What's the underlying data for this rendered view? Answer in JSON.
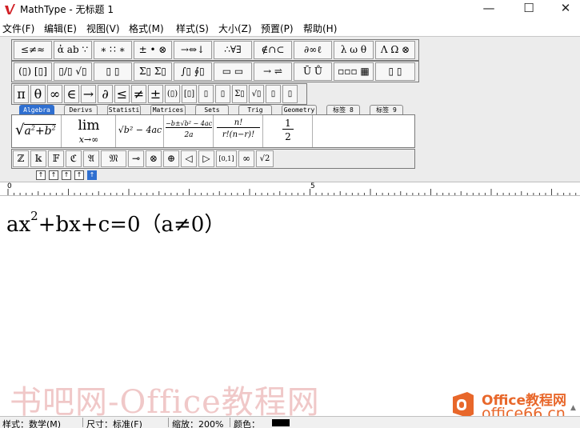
{
  "window": {
    "title": "MathType - 无标题 1",
    "controls": {
      "minimize": "—",
      "maximize": "☐",
      "close": "✕"
    }
  },
  "menu": [
    "文件(F)",
    "编辑(E)",
    "视图(V)",
    "格式(M)",
    "样式(S)",
    "大小(Z)",
    "预置(P)",
    "帮助(H)"
  ],
  "palettes": {
    "row1": [
      "≤≠≈",
      "ἀ ab ∵",
      "∗ ∷ ∗",
      "± • ⊗",
      "→⇔↓",
      "∴∀∃",
      "∉∩⊂",
      "∂∞ℓ",
      "λ ω θ",
      "Λ Ω ⊗"
    ],
    "row2": [
      "(▯) [▯]",
      "▯/▯ √▯",
      "▯ ▯",
      "Σ▯ Σ▯",
      "∫▯ ∮▯",
      "▭ ▭",
      "→ ⇌",
      "Ū Ů",
      "▫▫▫ ▦",
      "▯ ▯"
    ],
    "row3": [
      "π",
      "θ",
      "∞",
      "∈",
      "→",
      "∂",
      "≤",
      "≠",
      "±",
      "(▯)",
      "[▯]",
      "▯",
      "▯",
      "Σ▯",
      "√▯",
      "▯",
      "▯",
      "▯"
    ]
  },
  "tabs": [
    "Algebra",
    "Derivs",
    "Statisti",
    "Matrices",
    "Sets",
    "Trig",
    "Geometry",
    "标签 8",
    "标签 9"
  ],
  "templates": {
    "t1": {
      "radical": "√",
      "a": "a",
      "p2": "2",
      "plus": "+",
      "b": "b",
      "p2b": "2"
    },
    "t2": {
      "lim": "lim",
      "sub": "x→∞"
    },
    "t3": {
      "expr": "√b² − 4ac"
    },
    "t4": {
      "num": "−b±√b² − 4ac",
      "den": "2a"
    },
    "t5": {
      "num": "n!",
      "den": "r!(n−r)!"
    },
    "t6": {
      "num": "1",
      "den": "2"
    }
  },
  "symbols": [
    "ℤ",
    "𝕜",
    "𝔽",
    "ℭ",
    "𝔄",
    "𝔐",
    "⊸",
    "⊗",
    "⊕",
    "◁",
    "▷",
    "[0,1]",
    "∞",
    "√2"
  ],
  "small_buttons": [
    "↑",
    "↑",
    "↑",
    "↑",
    "↑"
  ],
  "ruler": {
    "mark0": "0",
    "mark5": "5"
  },
  "equation": {
    "ax": "ax",
    "exp": "2",
    "rest": "+bx+c=0（a≠0）"
  },
  "watermark": {
    "text": "书吧网-Office教程网"
  },
  "brand": {
    "name": "Office教程网",
    "url": "office66.cn"
  },
  "status": {
    "style": "样式：数学(M)",
    "size": "尺寸：标准(F)",
    "zoom": "缩放：200%",
    "color": "颜色："
  },
  "colors": {
    "accent": "#2f6fd0",
    "brand": "#e8672a",
    "swatch": "#000000"
  },
  "icons": {
    "app": "mathtype-logo-icon"
  }
}
